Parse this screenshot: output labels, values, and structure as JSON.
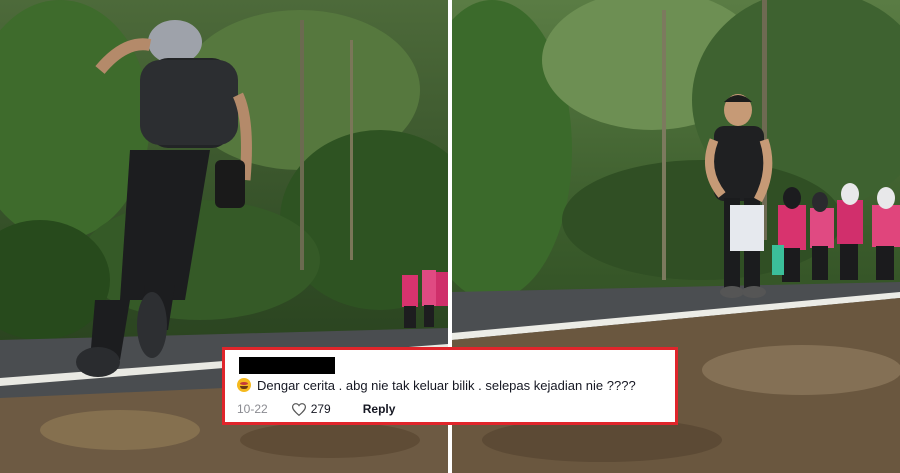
{
  "comment": {
    "username_redacted": true,
    "emoji_icon": "laughing-with-tears-emoji",
    "text": "Dengar cerita . abg nie tak keluar bilik . selepas kejadian nie ????",
    "date": "10-22",
    "likes": "279",
    "reply_label": "Reply",
    "border_color": "#e0252b"
  }
}
